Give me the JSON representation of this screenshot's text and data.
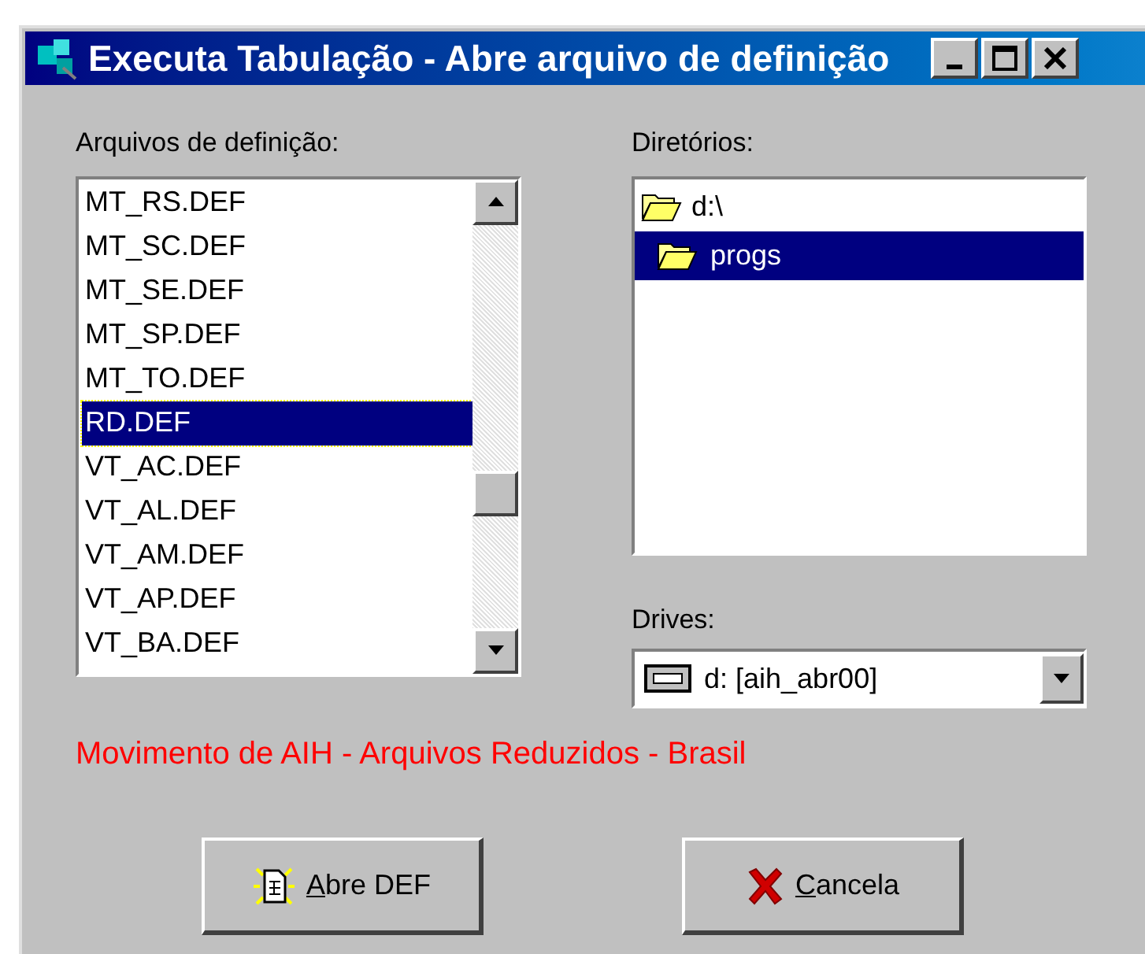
{
  "window": {
    "title": "Executa Tabulação - Abre arquivo de definição"
  },
  "files": {
    "label": "Arquivos de definição:",
    "items": [
      {
        "name": "MT_RS.DEF",
        "selected": false
      },
      {
        "name": "MT_SC.DEF",
        "selected": false
      },
      {
        "name": "MT_SE.DEF",
        "selected": false
      },
      {
        "name": "MT_SP.DEF",
        "selected": false
      },
      {
        "name": "MT_TO.DEF",
        "selected": false
      },
      {
        "name": "RD.DEF",
        "selected": true
      },
      {
        "name": "VT_AC.DEF",
        "selected": false
      },
      {
        "name": "VT_AL.DEF",
        "selected": false
      },
      {
        "name": "VT_AM.DEF",
        "selected": false
      },
      {
        "name": "VT_AP.DEF",
        "selected": false
      },
      {
        "name": "VT_BA.DEF",
        "selected": false
      }
    ]
  },
  "directories": {
    "label": "Diretórios:",
    "items": [
      {
        "name": "d:\\",
        "selected": false,
        "children": [
          {
            "name": "progs",
            "selected": true
          }
        ]
      }
    ]
  },
  "drives": {
    "label": "Drives:",
    "value": "d: [aih_abr00]"
  },
  "description": "Movimento de AIH - Arquivos Reduzidos - Brasil",
  "buttons": [
    {
      "kind": "open",
      "label": "Abre DEF",
      "underline_first": true
    },
    {
      "kind": "cancel",
      "label": "Cancela",
      "underline_first": true
    }
  ]
}
